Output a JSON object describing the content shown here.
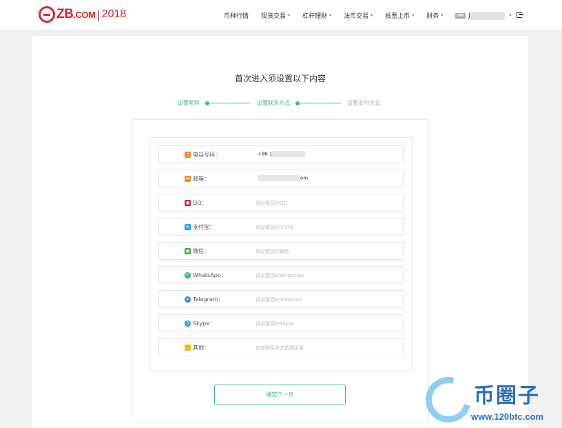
{
  "header": {
    "logo_text": "ZB",
    "logo_domain": ".COM",
    "logo_sep": "|",
    "logo_year": "2018",
    "nav": [
      {
        "label": "币种行情",
        "caret": false
      },
      {
        "label": "现货交易",
        "caret": true
      },
      {
        "label": "杠杆理财",
        "caret": true
      },
      {
        "label": "法币交易",
        "caret": true
      },
      {
        "label": "投票上币",
        "caret": true
      },
      {
        "label": "财务",
        "caret": true
      }
    ],
    "vip_label": "VIP0",
    "user_initial": "J",
    "caret_symbol": "▾"
  },
  "page": {
    "title": "首次进入须设置以下内容"
  },
  "steps": [
    {
      "label": "设置昵称",
      "done": true
    },
    {
      "label": "设置联系方式",
      "done": true
    },
    {
      "label": "设置支付方式",
      "done": false
    }
  ],
  "contact_rows": [
    {
      "key": "phone",
      "icon": "phone-icon",
      "icon_color": "#f08a24",
      "label": "电话号码：",
      "value": "+86 1",
      "placeholder": ""
    },
    {
      "key": "email",
      "icon": "email-icon",
      "icon_color": "#f08a24",
      "label": "邮箱：",
      "value": "om",
      "placeholder": ""
    },
    {
      "key": "qq",
      "icon": "qq-icon",
      "icon_color": "#d9232d",
      "label": "QQ：",
      "value": "",
      "placeholder": "请设置您的QQ"
    },
    {
      "key": "alipay",
      "icon": "alipay-icon",
      "icon_color": "#1a9fe0",
      "label": "支付宝：",
      "value": "",
      "placeholder": "请设置您的支付宝"
    },
    {
      "key": "wechat",
      "icon": "wechat-icon",
      "icon_color": "#3cb034",
      "label": "微信：",
      "value": "",
      "placeholder": "请设置您的微信"
    },
    {
      "key": "whatsapp",
      "icon": "whatsapp-icon",
      "icon_color": "#2fbe4f",
      "label": "WhatsApp：",
      "value": "",
      "placeholder": "请设置您的WhatsApp"
    },
    {
      "key": "telegram",
      "icon": "telegram-icon",
      "icon_color": "#2f8ad6",
      "label": "Telegram：",
      "value": "",
      "placeholder": "请设置您的Telegram"
    },
    {
      "key": "skype",
      "icon": "skype-icon",
      "icon_color": "#1fa0e8",
      "label": "Skype：",
      "value": "",
      "placeholder": "请设置您的Skype"
    },
    {
      "key": "other",
      "icon": "other-icon",
      "icon_color": "#f3b81c",
      "label": "其他：",
      "value": "",
      "placeholder": "其他联系方式请填这里"
    }
  ],
  "next_button": "确定下一步",
  "watermark": {
    "text": "币圈子",
    "url": "www.120btc.com"
  }
}
